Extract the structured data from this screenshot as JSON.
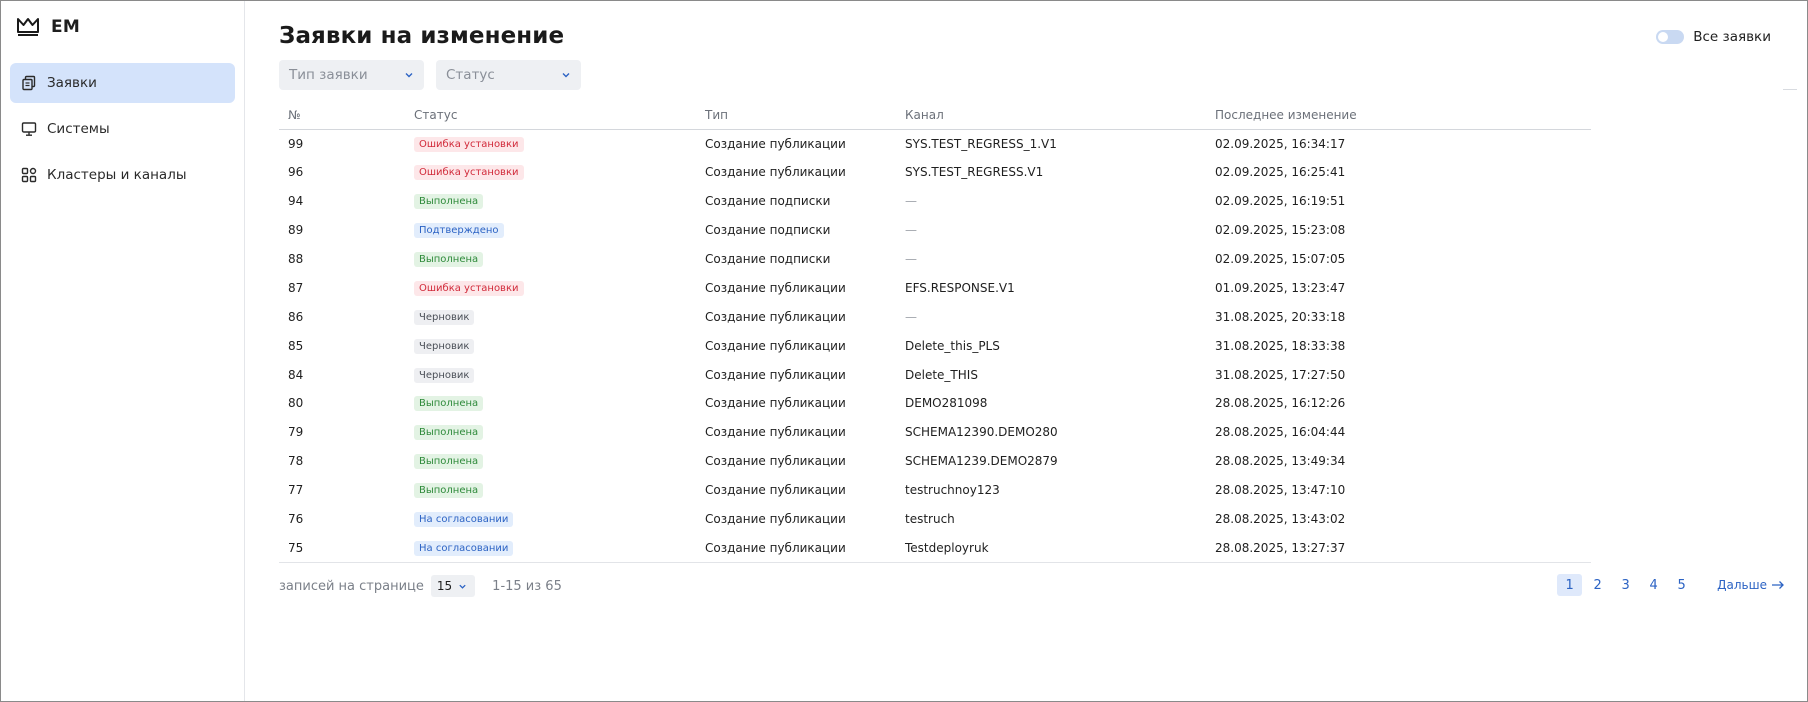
{
  "brand": {
    "name": "EM"
  },
  "sidebar": {
    "items": [
      {
        "label": "Заявки",
        "icon": "copy-document-icon",
        "active": true
      },
      {
        "label": "Системы",
        "icon": "monitor-icon",
        "active": false
      },
      {
        "label": "Кластеры и каналы",
        "icon": "grid-cluster-icon",
        "active": false
      }
    ]
  },
  "header": {
    "title": "Заявки на изменение",
    "toggle_label": "Все заявки",
    "toggle_on": false
  },
  "filters": {
    "type_placeholder": "Тип заявки",
    "status_placeholder": "Статус"
  },
  "table": {
    "columns": [
      "№",
      "Статус",
      "Тип",
      "Канал",
      "Последнее изменение"
    ],
    "rows": [
      {
        "id": "99",
        "status": "Ошибка установки",
        "status_kind": "error",
        "type": "Создание публикации",
        "channel": "SYS.TEST_REGRESS_1.V1",
        "updated": "02.09.2025, 16:34:17"
      },
      {
        "id": "96",
        "status": "Ошибка установки",
        "status_kind": "error",
        "type": "Создание публикации",
        "channel": "SYS.TEST_REGRESS.V1",
        "updated": "02.09.2025, 16:25:41"
      },
      {
        "id": "94",
        "status": "Выполнена",
        "status_kind": "done",
        "type": "Создание подписки",
        "channel": "—",
        "updated": "02.09.2025, 16:19:51"
      },
      {
        "id": "89",
        "status": "Подтверждено",
        "status_kind": "confirmed",
        "type": "Создание подписки",
        "channel": "—",
        "updated": "02.09.2025, 15:23:08"
      },
      {
        "id": "88",
        "status": "Выполнена",
        "status_kind": "done",
        "type": "Создание подписки",
        "channel": "—",
        "updated": "02.09.2025, 15:07:05"
      },
      {
        "id": "87",
        "status": "Ошибка установки",
        "status_kind": "error",
        "type": "Создание публикации",
        "channel": "EFS.RESPONSE.V1",
        "updated": "01.09.2025, 13:23:47"
      },
      {
        "id": "86",
        "status": "Черновик",
        "status_kind": "draft",
        "type": "Создание публикации",
        "channel": "—",
        "updated": "31.08.2025, 20:33:18"
      },
      {
        "id": "85",
        "status": "Черновик",
        "status_kind": "draft",
        "type": "Создание публикации",
        "channel": "Delete_this_PLS",
        "updated": "31.08.2025, 18:33:38"
      },
      {
        "id": "84",
        "status": "Черновик",
        "status_kind": "draft",
        "type": "Создание публикации",
        "channel": "Delete_THIS",
        "updated": "31.08.2025, 17:27:50"
      },
      {
        "id": "80",
        "status": "Выполнена",
        "status_kind": "done",
        "type": "Создание публикации",
        "channel": "DEMO281098",
        "updated": "28.08.2025, 16:12:26"
      },
      {
        "id": "79",
        "status": "Выполнена",
        "status_kind": "done",
        "type": "Создание публикации",
        "channel": "SCHEMA12390.DEMO280",
        "updated": "28.08.2025, 16:04:44"
      },
      {
        "id": "78",
        "status": "Выполнена",
        "status_kind": "done",
        "type": "Создание публикации",
        "channel": "SCHEMA1239.DEMO2879",
        "updated": "28.08.2025, 13:49:34"
      },
      {
        "id": "77",
        "status": "Выполнена",
        "status_kind": "done",
        "type": "Создание публикации",
        "channel": "testruchnoy123",
        "updated": "28.08.2025, 13:47:10"
      },
      {
        "id": "76",
        "status": "На согласовании",
        "status_kind": "review",
        "type": "Создание публикации",
        "channel": "testruch",
        "updated": "28.08.2025, 13:43:02"
      },
      {
        "id": "75",
        "status": "На согласовании",
        "status_kind": "review",
        "type": "Создание публикации",
        "channel": "Testdeployruk",
        "updated": "28.08.2025, 13:27:37"
      }
    ]
  },
  "footer": {
    "per_page_label": "записей на странице",
    "per_page_value": "15",
    "range_text": "1-15 из 65",
    "pages": [
      "1",
      "2",
      "3",
      "4",
      "5"
    ],
    "current_page": "1",
    "next_label": "Дальше"
  },
  "colors": {
    "accent": "#2c63c4",
    "active_nav_bg": "#d4e3fb",
    "error": "#d12a3a",
    "success": "#2e8a3a"
  }
}
